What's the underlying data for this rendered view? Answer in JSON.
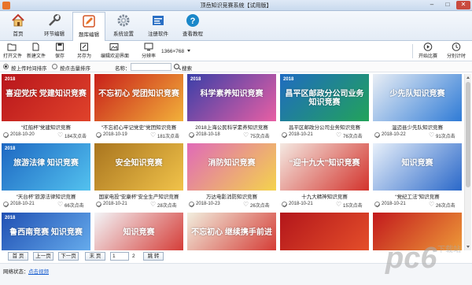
{
  "window": {
    "title": "顶岳知识竞赛系统【试用版】"
  },
  "ribbon": [
    {
      "label": "首页",
      "icon": "home-icon"
    },
    {
      "label": "环节编辑",
      "icon": "wrench-icon"
    },
    {
      "label": "题库编辑",
      "icon": "edit-icon"
    },
    {
      "label": "系统设置",
      "icon": "gear-icon"
    },
    {
      "label": "注册软件",
      "icon": "register-icon"
    },
    {
      "label": "查看教程",
      "icon": "help-icon"
    }
  ],
  "toolbar": {
    "open": "打开文件",
    "new": "新建文件",
    "save": "保存",
    "save_as": "另存为",
    "edit_welcome": "编辑欢迎界面",
    "resolution_label": "分辨率",
    "resolution": "1366×768",
    "start": "开始比赛",
    "timer": "分别计时"
  },
  "filter": {
    "sort_time": "按上传时间排序",
    "sort_clicks": "按点击量排序",
    "name_label": "名称：",
    "search": "搜索"
  },
  "cards": [
    {
      "title": "“红船杯”党建知识竞赛",
      "date": "2018-10-20",
      "clicks": "184次点击",
      "thumb": "喜迎党庆 党建知识竞赛",
      "year": "2018",
      "color": "#b8151b",
      "color2": "#e0432b"
    },
    {
      "title": "“不忘初心牢记党史”党团知识竞赛",
      "date": "2018-10-19",
      "clicks": "181次点击",
      "thumb": "不忘初心 党团知识竞赛",
      "year": "",
      "color": "#c81f1a",
      "color2": "#f2b13a"
    },
    {
      "title": "2018上海公民科学素养知识竞赛",
      "date": "2018-10-18",
      "clicks": "75次点击",
      "thumb": "科学素养知识竞赛",
      "year": "2018",
      "color": "#3a3fa8",
      "color2": "#e85fa4"
    },
    {
      "title": "昌平区邮政分公司业务知识竞赛",
      "date": "2018-10-21",
      "clicks": "76次点击",
      "thumb": "昌平区邮政分公司业务 知识竞赛",
      "year": "2018",
      "color": "#1f6bc1",
      "color2": "#22a35a"
    },
    {
      "title": "温迈县少先队知识竞赛",
      "date": "2018-10-22",
      "clicks": "91次点击",
      "thumb": "少先队知识竞赛",
      "year": "",
      "color": "#e9eef5",
      "color2": "#2f7bd6"
    },
    {
      "title": "“天台杯”旅游法律知识竞赛",
      "date": "2018-10-21",
      "clicks": "66次点击",
      "thumb": "旅游法律 知识竞赛",
      "year": "2018",
      "color": "#1d67c2",
      "color2": "#53c2ef"
    },
    {
      "title": "国家电投“安康杯”安全生产知识竞赛",
      "date": "2018-10-21",
      "clicks": "28次点击",
      "thumb": "安全知识竞赛",
      "year": "",
      "color": "#a9751f",
      "color2": "#f1c34a"
    },
    {
      "title": "万达电影消防知识竞赛",
      "date": "2018-10-23",
      "clicks": "26次点击",
      "thumb": "消防知识竞赛",
      "year": "",
      "color": "#e06ab8",
      "color2": "#f4d34c"
    },
    {
      "title": "十九大精神知识竞赛",
      "date": "2018-10-21",
      "clicks": "15次点击",
      "thumb": "“迎十九大”知识竞赛",
      "year": "",
      "color": "#f4e9e2",
      "color2": "#d3332c"
    },
    {
      "title": "“党纪工法”知识竞赛",
      "date": "2018-10-21",
      "clicks": "26次点击",
      "thumb": "知识竞赛",
      "year": "",
      "color": "#e8f0fa",
      "color2": "#2a68c9"
    },
    {
      "title": "",
      "date": "",
      "clicks": "",
      "thumb": "鲁西南竞赛 知识竞赛",
      "year": "2018",
      "color": "#1f4fb3",
      "color2": "#6bb2f0"
    },
    {
      "title": "",
      "date": "",
      "clicks": "",
      "thumb": "知识竞赛",
      "year": "",
      "color": "#f3f5f8",
      "color2": "#d3302a"
    },
    {
      "title": "",
      "date": "",
      "clicks": "",
      "thumb": "不忘初心 继续携手前进",
      "year": "",
      "color": "#f1eede",
      "color2": "#d3302a"
    },
    {
      "title": "",
      "date": "",
      "clicks": "",
      "thumb": "",
      "year": "",
      "color": "#b3161b",
      "color2": "#e8532b"
    },
    {
      "title": "",
      "date": "",
      "clicks": "",
      "thumb": "",
      "year": "",
      "color": "#c2191d",
      "color2": "#f0a23a"
    }
  ],
  "pager": {
    "first": "首 页",
    "prev": "上一页",
    "next": "下一页",
    "last": "末 页",
    "page": "1",
    "total": "2",
    "go": "跳 转"
  },
  "status": {
    "label": "网络状态：",
    "link": "点击视频"
  },
  "watermark": {
    "text": "pc6",
    "sub": "下载站"
  }
}
